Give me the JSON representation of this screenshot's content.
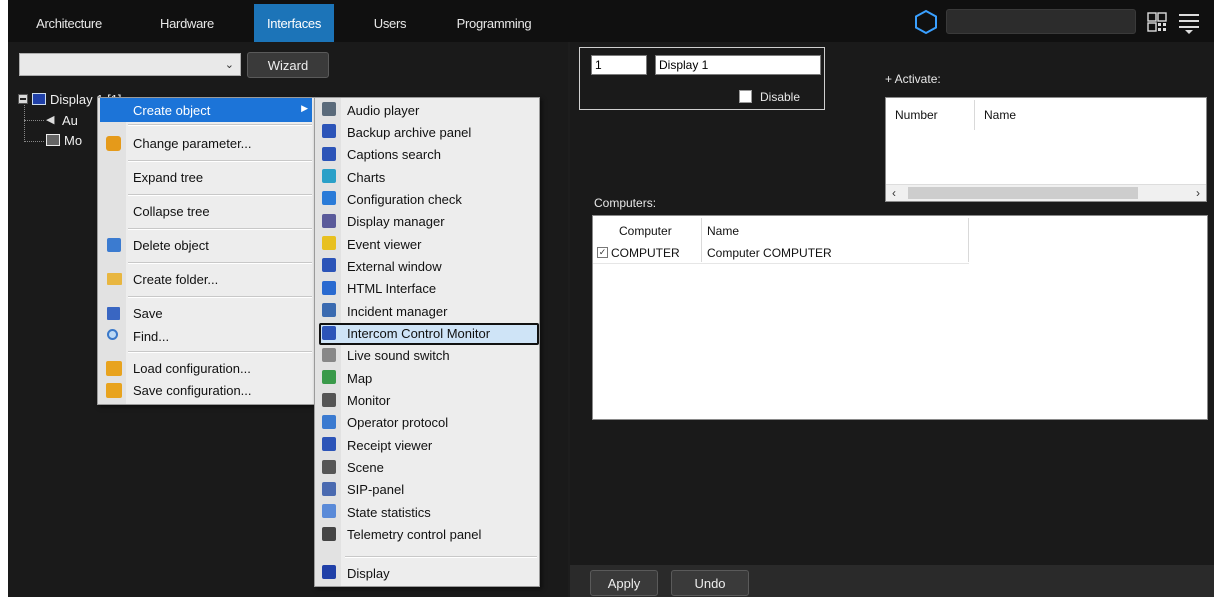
{
  "nav": {
    "tabs": [
      {
        "label": "Architecture"
      },
      {
        "label": "Hardware"
      },
      {
        "label": "Interfaces",
        "active": true
      },
      {
        "label": "Users"
      },
      {
        "label": "Programming"
      }
    ],
    "icons": [
      "hexagon-icon",
      "grid-view-icon",
      "menu-icon"
    ]
  },
  "left": {
    "wizard_label": "Wizard",
    "tree": {
      "root_label": "Display 1 [1]",
      "child1_label": "Au",
      "child2_label": "Mo"
    }
  },
  "context_menu": {
    "items": [
      {
        "label": "Create object",
        "highlighted": true,
        "has_submenu": true
      },
      {
        "label": "Change parameter..."
      },
      {
        "label": "Expand tree"
      },
      {
        "label": "Collapse tree"
      },
      {
        "label": "Delete object"
      },
      {
        "label": "Create folder..."
      },
      {
        "label": "Save"
      },
      {
        "label": "Find..."
      },
      {
        "label": "Load configuration..."
      },
      {
        "label": "Save configuration..."
      }
    ]
  },
  "submenu": {
    "items": [
      {
        "label": "Audio player",
        "icon": "speaker-icon"
      },
      {
        "label": "Backup archive panel",
        "icon": "monitor-icon"
      },
      {
        "label": "Captions search",
        "icon": "monitor-icon"
      },
      {
        "label": "Charts",
        "icon": "chart-icon"
      },
      {
        "label": "Configuration check",
        "icon": "check-icon"
      },
      {
        "label": "Display manager",
        "icon": "grid-icon"
      },
      {
        "label": "Event viewer",
        "icon": "event-icon"
      },
      {
        "label": "External window",
        "icon": "monitor-icon"
      },
      {
        "label": "HTML Interface",
        "icon": "globe-icon"
      },
      {
        "label": "Incident manager",
        "icon": "incident-icon"
      },
      {
        "label": "Intercom Control Monitor",
        "icon": "monitor-icon",
        "boxed": true
      },
      {
        "label": "Live sound switch",
        "icon": "switch-icon"
      },
      {
        "label": "Map",
        "icon": "map-icon"
      },
      {
        "label": "Monitor",
        "icon": "camera-monitor-icon"
      },
      {
        "label": "Operator protocol",
        "icon": "protocol-icon"
      },
      {
        "label": "Receipt viewer",
        "icon": "monitor-icon"
      },
      {
        "label": "Scene",
        "icon": "scene-icon"
      },
      {
        "label": "SIP-panel",
        "icon": "sip-icon"
      },
      {
        "label": "State statistics",
        "icon": "stats-icon"
      },
      {
        "label": "Telemetry control panel",
        "icon": "telemetry-icon"
      },
      {
        "label": "Display",
        "icon": "display-icon"
      }
    ]
  },
  "right": {
    "id_value": "1",
    "name_value": "Display 1",
    "disable_label": "Disable",
    "activate_label": "+ Activate:",
    "activate_table": {
      "headers": [
        "Number",
        "Name"
      ],
      "rows": []
    },
    "computers_label": "Computers:",
    "computers_table": {
      "headers": [
        "Computer",
        "Name"
      ],
      "rows": [
        {
          "checked": true,
          "computer": "COMPUTER",
          "name": "Computer COMPUTER"
        }
      ]
    },
    "apply_label": "Apply",
    "undo_label": "Undo"
  },
  "colors": {
    "accent": "#1c74b8",
    "highlight": "#1c74d8",
    "background": "#1d1d1d"
  }
}
